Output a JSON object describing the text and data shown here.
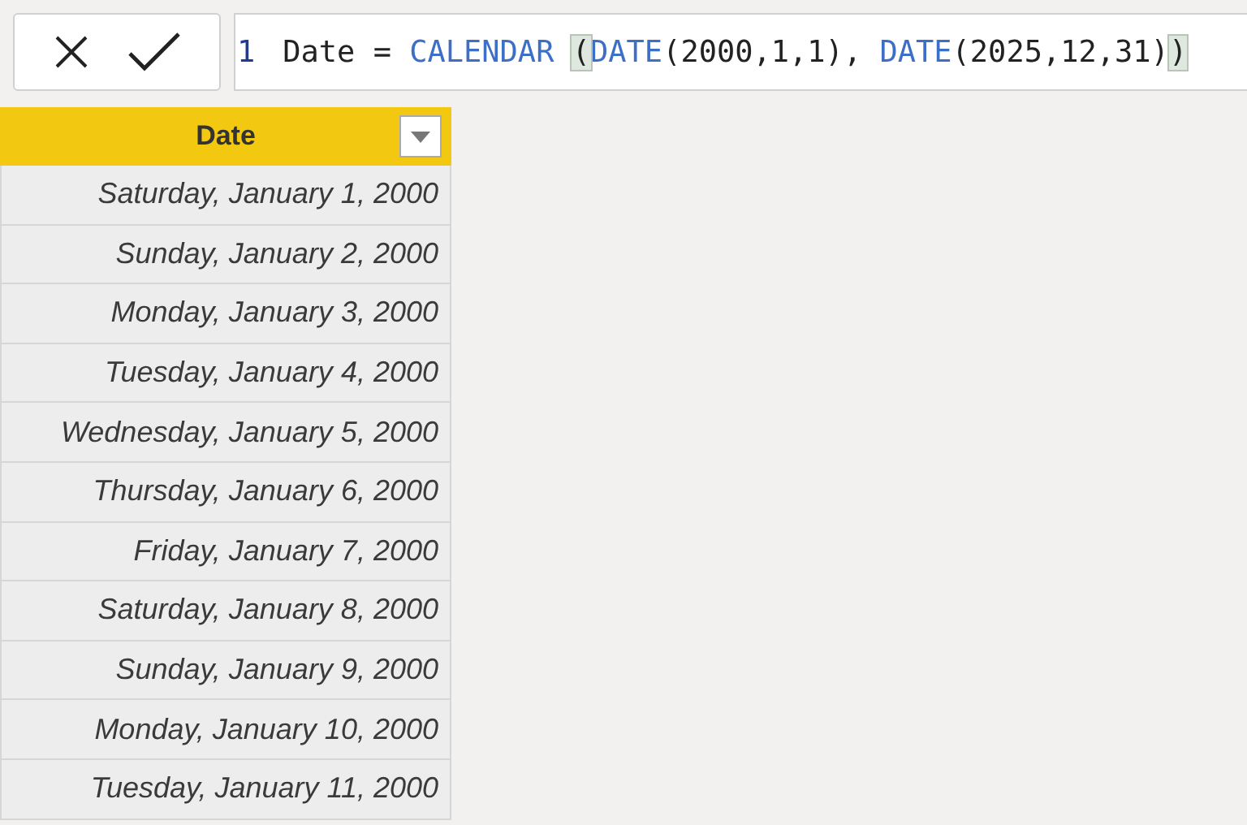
{
  "formula_bar": {
    "line_number": "1",
    "tokens": [
      {
        "kind": "plain",
        "text": "Date = "
      },
      {
        "kind": "function",
        "text": "CALENDAR "
      },
      {
        "kind": "bracket",
        "text": "("
      },
      {
        "kind": "function",
        "text": "DATE"
      },
      {
        "kind": "plain",
        "text": "(2000,1,1), "
      },
      {
        "kind": "function",
        "text": "DATE"
      },
      {
        "kind": "plain",
        "text": "(2025,12,31)"
      },
      {
        "kind": "bracket",
        "text": ")"
      }
    ]
  },
  "table": {
    "columns": [
      {
        "label": "Date"
      }
    ],
    "rows": [
      "Saturday, January 1, 2000",
      "Sunday, January 2, 2000",
      "Monday, January 3, 2000",
      "Tuesday, January 4, 2000",
      "Wednesday, January 5, 2000",
      "Thursday, January 6, 2000",
      "Friday, January 7, 2000",
      "Saturday, January 8, 2000",
      "Sunday, January 9, 2000",
      "Monday, January 10, 2000",
      "Tuesday, January 11, 2000"
    ]
  }
}
